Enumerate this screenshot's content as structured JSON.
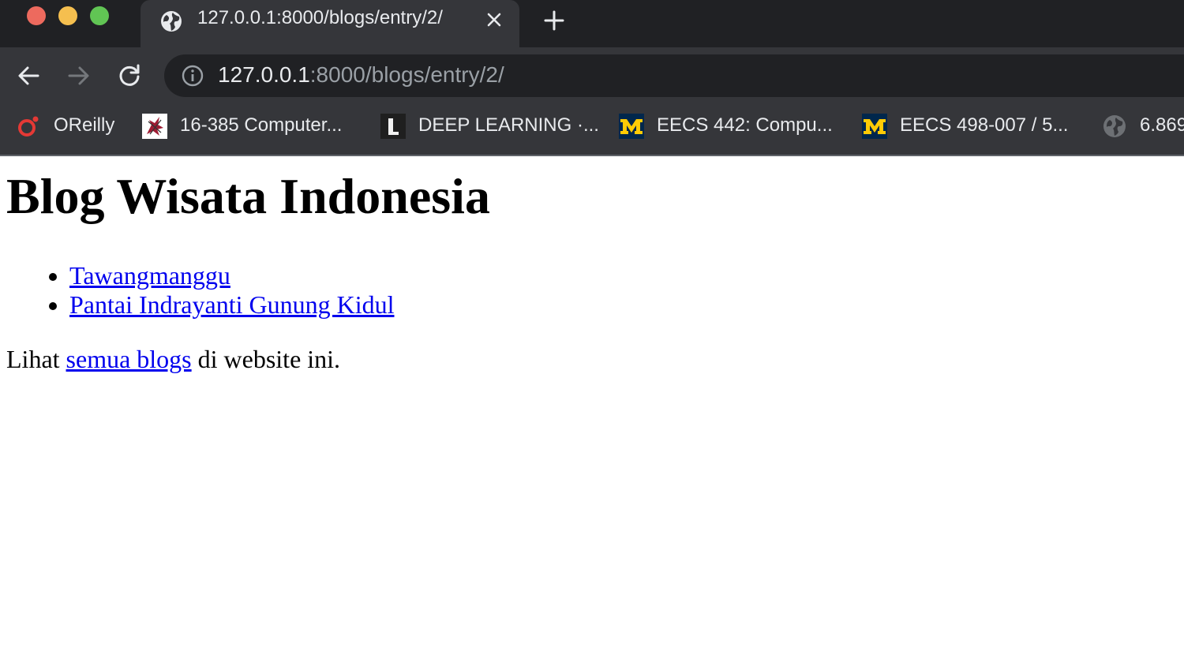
{
  "browser": {
    "tab": {
      "title": "127.0.0.1:8000/blogs/entry/2/"
    },
    "address": {
      "host": "127.0.0.1",
      "path": ":8000/blogs/entry/2/"
    },
    "bookmarks": [
      {
        "label": "OReilly",
        "icon": "oreilly-icon"
      },
      {
        "label": "16-385 Computer...",
        "icon": "cmu-icon"
      },
      {
        "label": "DEEP LEARNING ·...",
        "icon": "l-icon"
      },
      {
        "label": "EECS 442: Compu...",
        "icon": "umich-icon"
      },
      {
        "label": "EECS 498-007 / 5...",
        "icon": "umich-icon"
      },
      {
        "label": "6.869",
        "icon": "globe-icon"
      }
    ],
    "colors": {
      "frame": "#202124",
      "toolbar": "#35363a",
      "text": "#e8eaed",
      "muted": "#9aa0a6"
    }
  },
  "page": {
    "title": "Blog Wisata Indonesia",
    "entries": [
      {
        "label": "Tawangmanggu"
      },
      {
        "label": "Pantai Indrayanti Gunung Kidul"
      }
    ],
    "footer": {
      "prefix": "Lihat ",
      "link": "semua blogs",
      "suffix": " di website ini."
    },
    "colors": {
      "link": "#0000ee",
      "text": "#000000"
    }
  }
}
